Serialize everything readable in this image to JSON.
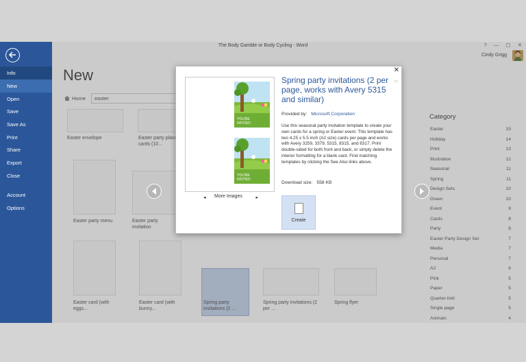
{
  "window": {
    "title": "The Body Gamble or Body Cycling - Word",
    "help": "?",
    "minimize": "—",
    "restore": "▢",
    "close": "✕",
    "user": "Cindy Grigg"
  },
  "sidebar": {
    "items": [
      "Info",
      "New",
      "Open",
      "Save",
      "Save As",
      "Print",
      "Share",
      "Export",
      "Close",
      "Account",
      "Options"
    ],
    "active": "New"
  },
  "page": {
    "title": "New",
    "home": "Home",
    "search_value": "easter"
  },
  "templates": [
    {
      "label": "Easter envelope"
    },
    {
      "label": "Easter party place cards (10..."
    },
    {
      "label": "Easter party menu"
    },
    {
      "label": "Easter party invitation"
    },
    {
      "label": "Easter card (with eggs..."
    },
    {
      "label": "Easter card (with bunny..."
    },
    {
      "label": "Spring party invitations (2 ..."
    },
    {
      "label": "Spring party invitations (2 per ..."
    },
    {
      "label": "Spring flyer"
    }
  ],
  "categories": {
    "title": "Category",
    "items": [
      {
        "name": "Easter",
        "count": "15"
      },
      {
        "name": "Holiday",
        "count": "14"
      },
      {
        "name": "Print",
        "count": "13"
      },
      {
        "name": "Illustration",
        "count": "12"
      },
      {
        "name": "Seasonal",
        "count": "11"
      },
      {
        "name": "Spring",
        "count": "11"
      },
      {
        "name": "Design Sets",
        "count": "10"
      },
      {
        "name": "Green",
        "count": "10"
      },
      {
        "name": "Event",
        "count": "9"
      },
      {
        "name": "Cards",
        "count": "8"
      },
      {
        "name": "Party",
        "count": "8"
      },
      {
        "name": "Easter Party Design Set",
        "count": "7"
      },
      {
        "name": "Media",
        "count": "7"
      },
      {
        "name": "Personal",
        "count": "7"
      },
      {
        "name": "A2",
        "count": "6"
      },
      {
        "name": "Pink",
        "count": "5"
      },
      {
        "name": "Paper",
        "count": "5"
      },
      {
        "name": "Quarter-fold",
        "count": "5"
      },
      {
        "name": "Single page",
        "count": "5"
      },
      {
        "name": "Animals",
        "count": "4"
      }
    ]
  },
  "dialog": {
    "title": "Spring party invitations (2 per page, works with Avery 5315 and similar)",
    "provided_label": "Provided by:",
    "provider": "Microsoft Corporation",
    "description": "Use this seasonal party invitation template to create your own cards for a spring or Easter event. This template has two 4.25 x 5.5 inch (A2 size) cards per page and works with Avery 3259, 3379, 5315, 8315, and 8317. Print double-sided for both front and back, or simply delete the interior formatting for a blank card. Find matching templates by clicking the See Also links above.",
    "download_label": "Download size:",
    "download_size": "558 KB",
    "create_label": "Create",
    "more_images": "More Images",
    "card_text": [
      "YOU'RE",
      "INVITED"
    ]
  }
}
